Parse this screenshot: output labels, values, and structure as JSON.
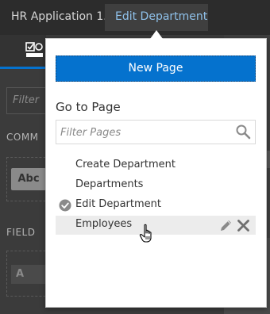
{
  "breadcrumb": {
    "app": "HR Application 1.0",
    "page": "Edit Department"
  },
  "background_panel": {
    "filter_placeholder": "Filter",
    "section_common": "COMM",
    "button_text": "Abc",
    "section_field": "FIELD",
    "field_text": "A"
  },
  "popup": {
    "new_page_label": "New Page",
    "goto_label": "Go to Page",
    "filter_placeholder": "Filter Pages",
    "pages": [
      {
        "label": "Create Department",
        "current": false
      },
      {
        "label": "Departments",
        "current": false
      },
      {
        "label": "Edit Department",
        "current": true
      },
      {
        "label": "Employees",
        "current": false,
        "hovered": true
      }
    ]
  },
  "colors": {
    "accent": "#0572ce",
    "breadcrumb_active": "#8fc1ea"
  }
}
